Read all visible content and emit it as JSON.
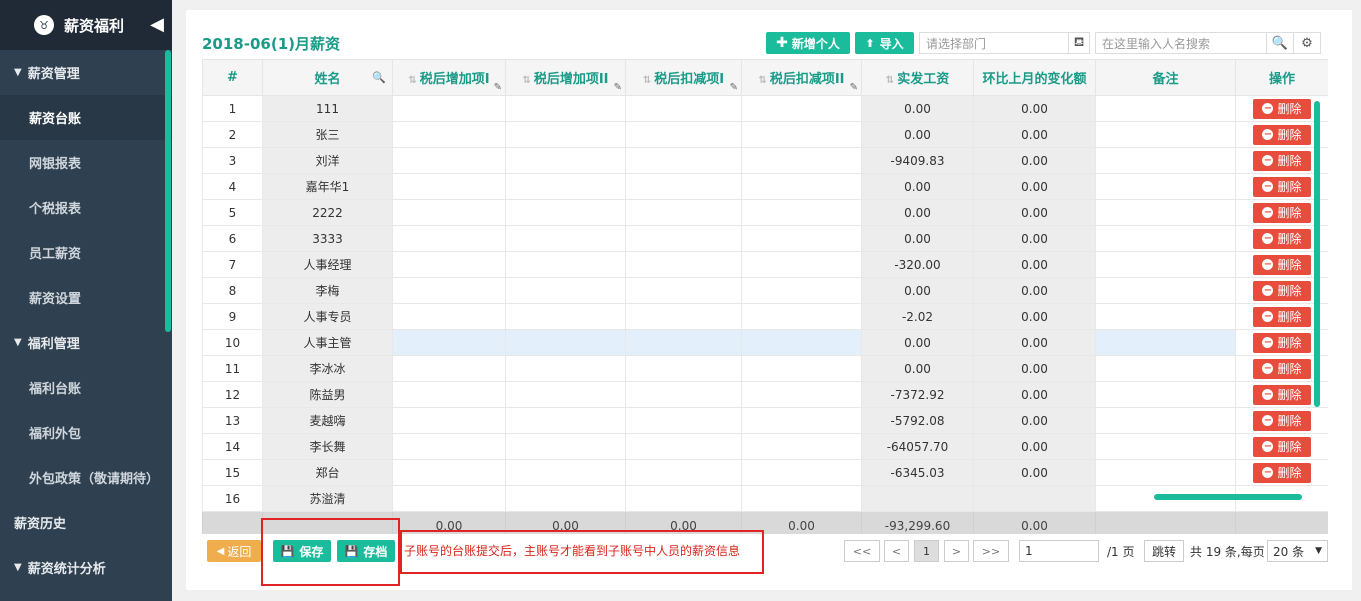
{
  "sidebar": {
    "brand": "薪资福利",
    "logo_char": "♉",
    "collapse_char": "◀",
    "groups": [
      {
        "label": "薪资管理",
        "items": [
          "薪资台账",
          "网银报表",
          "个税报表",
          "员工薪资",
          "薪资设置"
        ]
      },
      {
        "label": "福利管理",
        "items": [
          "福利台账",
          "福利外包",
          "外包政策（敬请期待）"
        ]
      }
    ],
    "history": "薪资历史",
    "stats": "薪资统计分析",
    "active_item": "薪资台账"
  },
  "header": {
    "title": "2018-06(1)月薪资",
    "add_person": "新增个人",
    "import": "导入",
    "dept_placeholder": "请选择部门",
    "search_placeholder": "在这里输入人名搜索"
  },
  "table": {
    "columns": [
      "#",
      "姓名",
      "税后增加项I",
      "税后增加项II",
      "税后扣减项I",
      "税后扣减项II",
      "实发工资",
      "环比上月的变化额",
      "备注",
      "操作"
    ],
    "delete_label": "删除",
    "rows": [
      {
        "no": "1",
        "name": "111",
        "pay": "0.00",
        "change": "0.00"
      },
      {
        "no": "2",
        "name": "张三",
        "pay": "0.00",
        "change": "0.00"
      },
      {
        "no": "3",
        "name": "刘洋",
        "pay": "-9409.83",
        "change": "0.00"
      },
      {
        "no": "4",
        "name": "嘉年华1",
        "pay": "0.00",
        "change": "0.00"
      },
      {
        "no": "5",
        "name": "2222",
        "pay": "0.00",
        "change": "0.00"
      },
      {
        "no": "6",
        "name": "3333",
        "pay": "0.00",
        "change": "0.00"
      },
      {
        "no": "7",
        "name": "人事经理",
        "pay": "-320.00",
        "change": "0.00"
      },
      {
        "no": "8",
        "name": "李梅",
        "pay": "0.00",
        "change": "0.00"
      },
      {
        "no": "9",
        "name": "人事专员",
        "pay": "-2.02",
        "change": "0.00"
      },
      {
        "no": "10",
        "name": "人事主管",
        "pay": "0.00",
        "change": "0.00"
      },
      {
        "no": "11",
        "name": "李冰冰",
        "pay": "0.00",
        "change": "0.00"
      },
      {
        "no": "12",
        "name": "陈益男",
        "pay": "-7372.92",
        "change": "0.00"
      },
      {
        "no": "13",
        "name": "麦越嗨",
        "pay": "-5792.08",
        "change": "0.00"
      },
      {
        "no": "14",
        "name": "李长舞",
        "pay": "-64057.70",
        "change": "0.00"
      },
      {
        "no": "15",
        "name": "郑台",
        "pay": "-6345.03",
        "change": "0.00"
      },
      {
        "no": "16",
        "name": "苏溢清",
        "pay": "",
        "change": ""
      }
    ],
    "totals": [
      "0.00",
      "0.00",
      "0.00",
      "0.00",
      "-93,299.60",
      "0.00"
    ]
  },
  "footer": {
    "back": "返回",
    "save": "保存",
    "archive": "存档",
    "note": "子账号的台账提交后，主账号才能看到子账号中人员的薪资信息",
    "first": "<<",
    "prev": "<",
    "current_page": "1",
    "next": ">",
    "last": ">>",
    "page_input": "1",
    "total_pages": "/1 页",
    "jump": "跳转",
    "summary": "共 19 条,每页",
    "page_size": "20 条"
  },
  "colors": {
    "accent": "#1abc9c",
    "danger": "#e74c3c",
    "warning": "#f0ad4e",
    "sidebar": "#2f4050"
  }
}
